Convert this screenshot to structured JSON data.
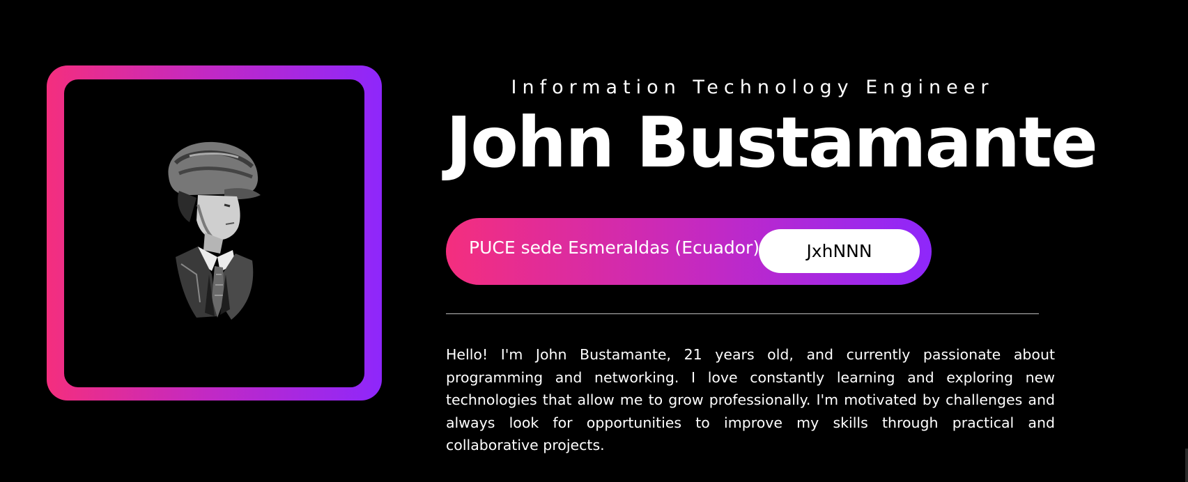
{
  "profile": {
    "subtitle": "Information Technology Engineer",
    "name": "John Bustamante",
    "portrait_icon": "portrait-illustration",
    "institution": "PUCE sede Esmeraldas (Ecuador)",
    "handle_button": "JxhNNN",
    "bio": "Hello! I'm John Bustamante, 21 years old, and currently passionate about programming and networking. I love constantly learning and exploring new technologies that allow me to grow professionally. I'm motivated by challenges and always look for opportunities to improve my skills through practical and collaborative projects."
  },
  "colors": {
    "background": "#000000",
    "gradient_start": "#f42e7e",
    "gradient_mid": "#c229c4",
    "gradient_end": "#8e27fb",
    "text": "#ffffff"
  }
}
